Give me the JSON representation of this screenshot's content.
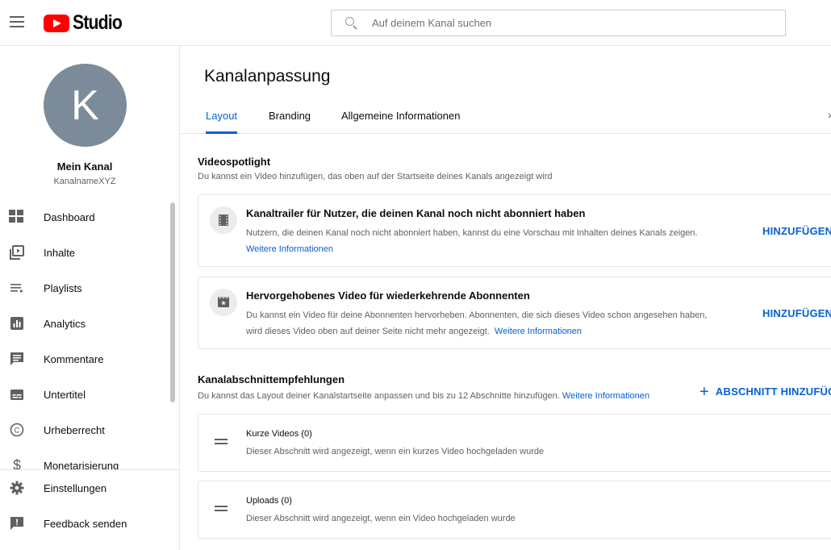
{
  "header": {
    "logo_text": "Studio",
    "search_placeholder": "Auf deinem Kanal suchen"
  },
  "sidebar": {
    "avatar_letter": "K",
    "channel_name": "Mein Kanal",
    "channel_handle": "KanalnameXYZ",
    "items": [
      {
        "label": "Dashboard",
        "icon": "dashboard-icon"
      },
      {
        "label": "Inhalte",
        "icon": "content-icon"
      },
      {
        "label": "Playlists",
        "icon": "playlists-icon"
      },
      {
        "label": "Analytics",
        "icon": "analytics-icon"
      },
      {
        "label": "Kommentare",
        "icon": "comments-icon"
      },
      {
        "label": "Untertitel",
        "icon": "subtitles-icon"
      },
      {
        "label": "Urheberrecht",
        "icon": "copyright-icon"
      },
      {
        "label": "Monetarisierung",
        "icon": "monetization-icon"
      }
    ],
    "bottom_items": [
      {
        "label": "Einstellungen",
        "icon": "gear-icon"
      },
      {
        "label": "Feedback senden",
        "icon": "feedback-icon"
      }
    ]
  },
  "main": {
    "title": "Kanalanpassung",
    "tabs": [
      {
        "label": "Layout",
        "active": true
      },
      {
        "label": "Branding",
        "active": false
      },
      {
        "label": "Allgemeine Informationen",
        "active": false
      }
    ],
    "spotlight": {
      "title": "Videospotlight",
      "description": "Du kannst ein Video hinzufügen, das oben auf der Startseite deines Kanals angezeigt wird",
      "cards": [
        {
          "title": "Kanaltrailer für Nutzer, die deinen Kanal noch nicht abonniert haben",
          "text": "Nutzern, die deinen Kanal noch nicht abonniert haben, kannst du eine Vorschau mit Inhalten deines Kanals zeigen.",
          "link": "Weitere Informationen",
          "action": "HINZUFÜGEN"
        },
        {
          "title": "Hervorgehobenes Video für wiederkehrende Abonnenten",
          "text_line1": "Du kannst ein Video für deine Abonnenten hervorheben. Abonnenten, die sich dieses Video schon angesehen haben,",
          "text_line2": "wird dieses Video oben auf deiner Seite nicht mehr angezeigt.",
          "link": "Weitere Informationen",
          "action": "HINZUFÜGEN"
        }
      ]
    },
    "sections": {
      "title": "Kanalabschnittempfehlungen",
      "description": "Du kannst das Layout deiner Kanalstartseite anpassen und bis zu 12 Abschnitte hinzufügen.",
      "link": "Weitere Informationen",
      "add_button": "ABSCHNITT HINZUFÜGEN",
      "rows": [
        {
          "title": "Kurze Videos",
          "count": "(0)",
          "description": "Dieser Abschnitt wird angezeigt, wenn ein kurzes Video hochgeladen wurde"
        },
        {
          "title": "Uploads",
          "count": "(0)",
          "description": "Dieser Abschnitt wird angezeigt, wenn ein Video hochgeladen wurde"
        }
      ]
    }
  },
  "colors": {
    "accent": "#065fd4",
    "brand_red": "#ff0000",
    "avatar_bg": "#7b8b99"
  }
}
